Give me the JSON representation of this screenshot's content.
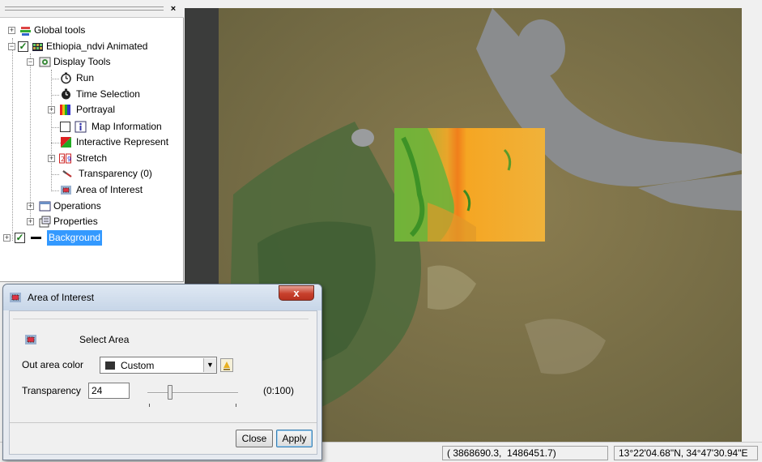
{
  "tree": {
    "close_glyph": "×",
    "nodes": [
      {
        "label": "Global tools",
        "icon": "global-tools-icon"
      },
      {
        "label": "Ethiopia_ndvi  Animated",
        "icon": "raster-layer-icon",
        "checked": true
      },
      {
        "label": "Display Tools",
        "icon": "display-tools-icon"
      },
      {
        "label": "Run",
        "icon": "run-icon"
      },
      {
        "label": "Time Selection",
        "icon": "time-selection-icon"
      },
      {
        "label": "Portrayal",
        "icon": "portrayal-icon"
      },
      {
        "label": "Map Information",
        "icon": "map-information-icon",
        "checked": false
      },
      {
        "label": "Interactive Represent",
        "icon": "interactive-representation-icon"
      },
      {
        "label": "Stretch",
        "icon": "stretch-icon"
      },
      {
        "label": "Transparency (0)",
        "icon": "transparency-icon"
      },
      {
        "label": "Area of Interest",
        "icon": "area-of-interest-icon"
      },
      {
        "label": "Operations",
        "icon": "operations-icon"
      },
      {
        "label": "Properties",
        "icon": "properties-icon"
      },
      {
        "label": "Background",
        "icon": "background-layer-icon",
        "checked": true,
        "selected": true
      }
    ]
  },
  "dialog": {
    "title": "Area of Interest",
    "close_glyph": "x",
    "select_area_label": "Select Area",
    "out_area_color_label": "Out area color",
    "out_area_color_value": "Custom",
    "out_area_color_swatch": "#333333",
    "transparency_label": "Transparency",
    "transparency_value": "24",
    "transparency_range_label": "(0:100)",
    "transparency_level": 0.24,
    "close_button": "Close",
    "apply_button": "Apply"
  },
  "status": {
    "projected_coords": "( 3868690.3,  1486451.7)",
    "geo_coords": "13°22'04.68\"N, 34°47'30.94\"E"
  },
  "colors": {
    "selection": "#3399ff",
    "ndvi_high": "#3fae2a",
    "ndvi_low": "#f0a020"
  }
}
